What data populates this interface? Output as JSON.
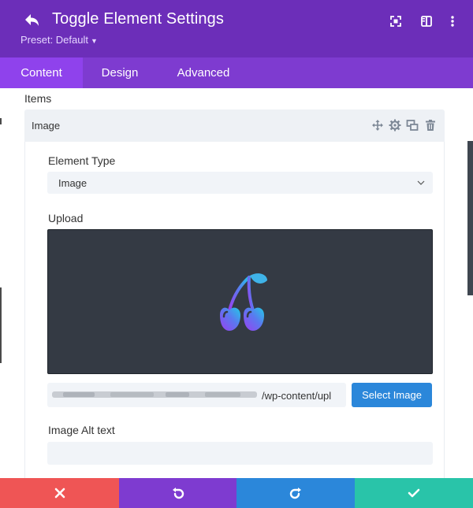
{
  "header": {
    "title": "Toggle Element Settings",
    "preset_label": "Preset: Default",
    "icons": [
      "back-arrow-icon",
      "fullscreen-icon",
      "split-view-icon",
      "more-vertical-icon"
    ]
  },
  "tabs": [
    {
      "label": "Content",
      "active": true
    },
    {
      "label": "Design",
      "active": false
    },
    {
      "label": "Advanced",
      "active": false
    }
  ],
  "content": {
    "items_label": "Items",
    "item": {
      "name": "Image",
      "actions": [
        "move-icon",
        "settings-icon",
        "duplicate-icon",
        "delete-icon"
      ]
    },
    "element_type": {
      "label": "Element Type",
      "value": "Image"
    },
    "upload": {
      "label": "Upload",
      "url_visible": "/wp-content/upl",
      "button_label": "Select Image"
    },
    "alt_text": {
      "label": "Image Alt text",
      "value": "",
      "placeholder": ""
    }
  },
  "footer": {
    "buttons": [
      {
        "icon": "close-icon",
        "color": "#ef5555"
      },
      {
        "icon": "undo-icon",
        "color": "#7e3bd0"
      },
      {
        "icon": "redo-icon",
        "color": "#2b87da"
      },
      {
        "icon": "check-icon",
        "color": "#29c4a9"
      }
    ]
  },
  "colors": {
    "header": "#6c2eb9",
    "tab_bar": "#7e3bd0",
    "tab_active": "#8f42ec",
    "primary_button": "#2b87da",
    "upload_background": "#343a44"
  }
}
